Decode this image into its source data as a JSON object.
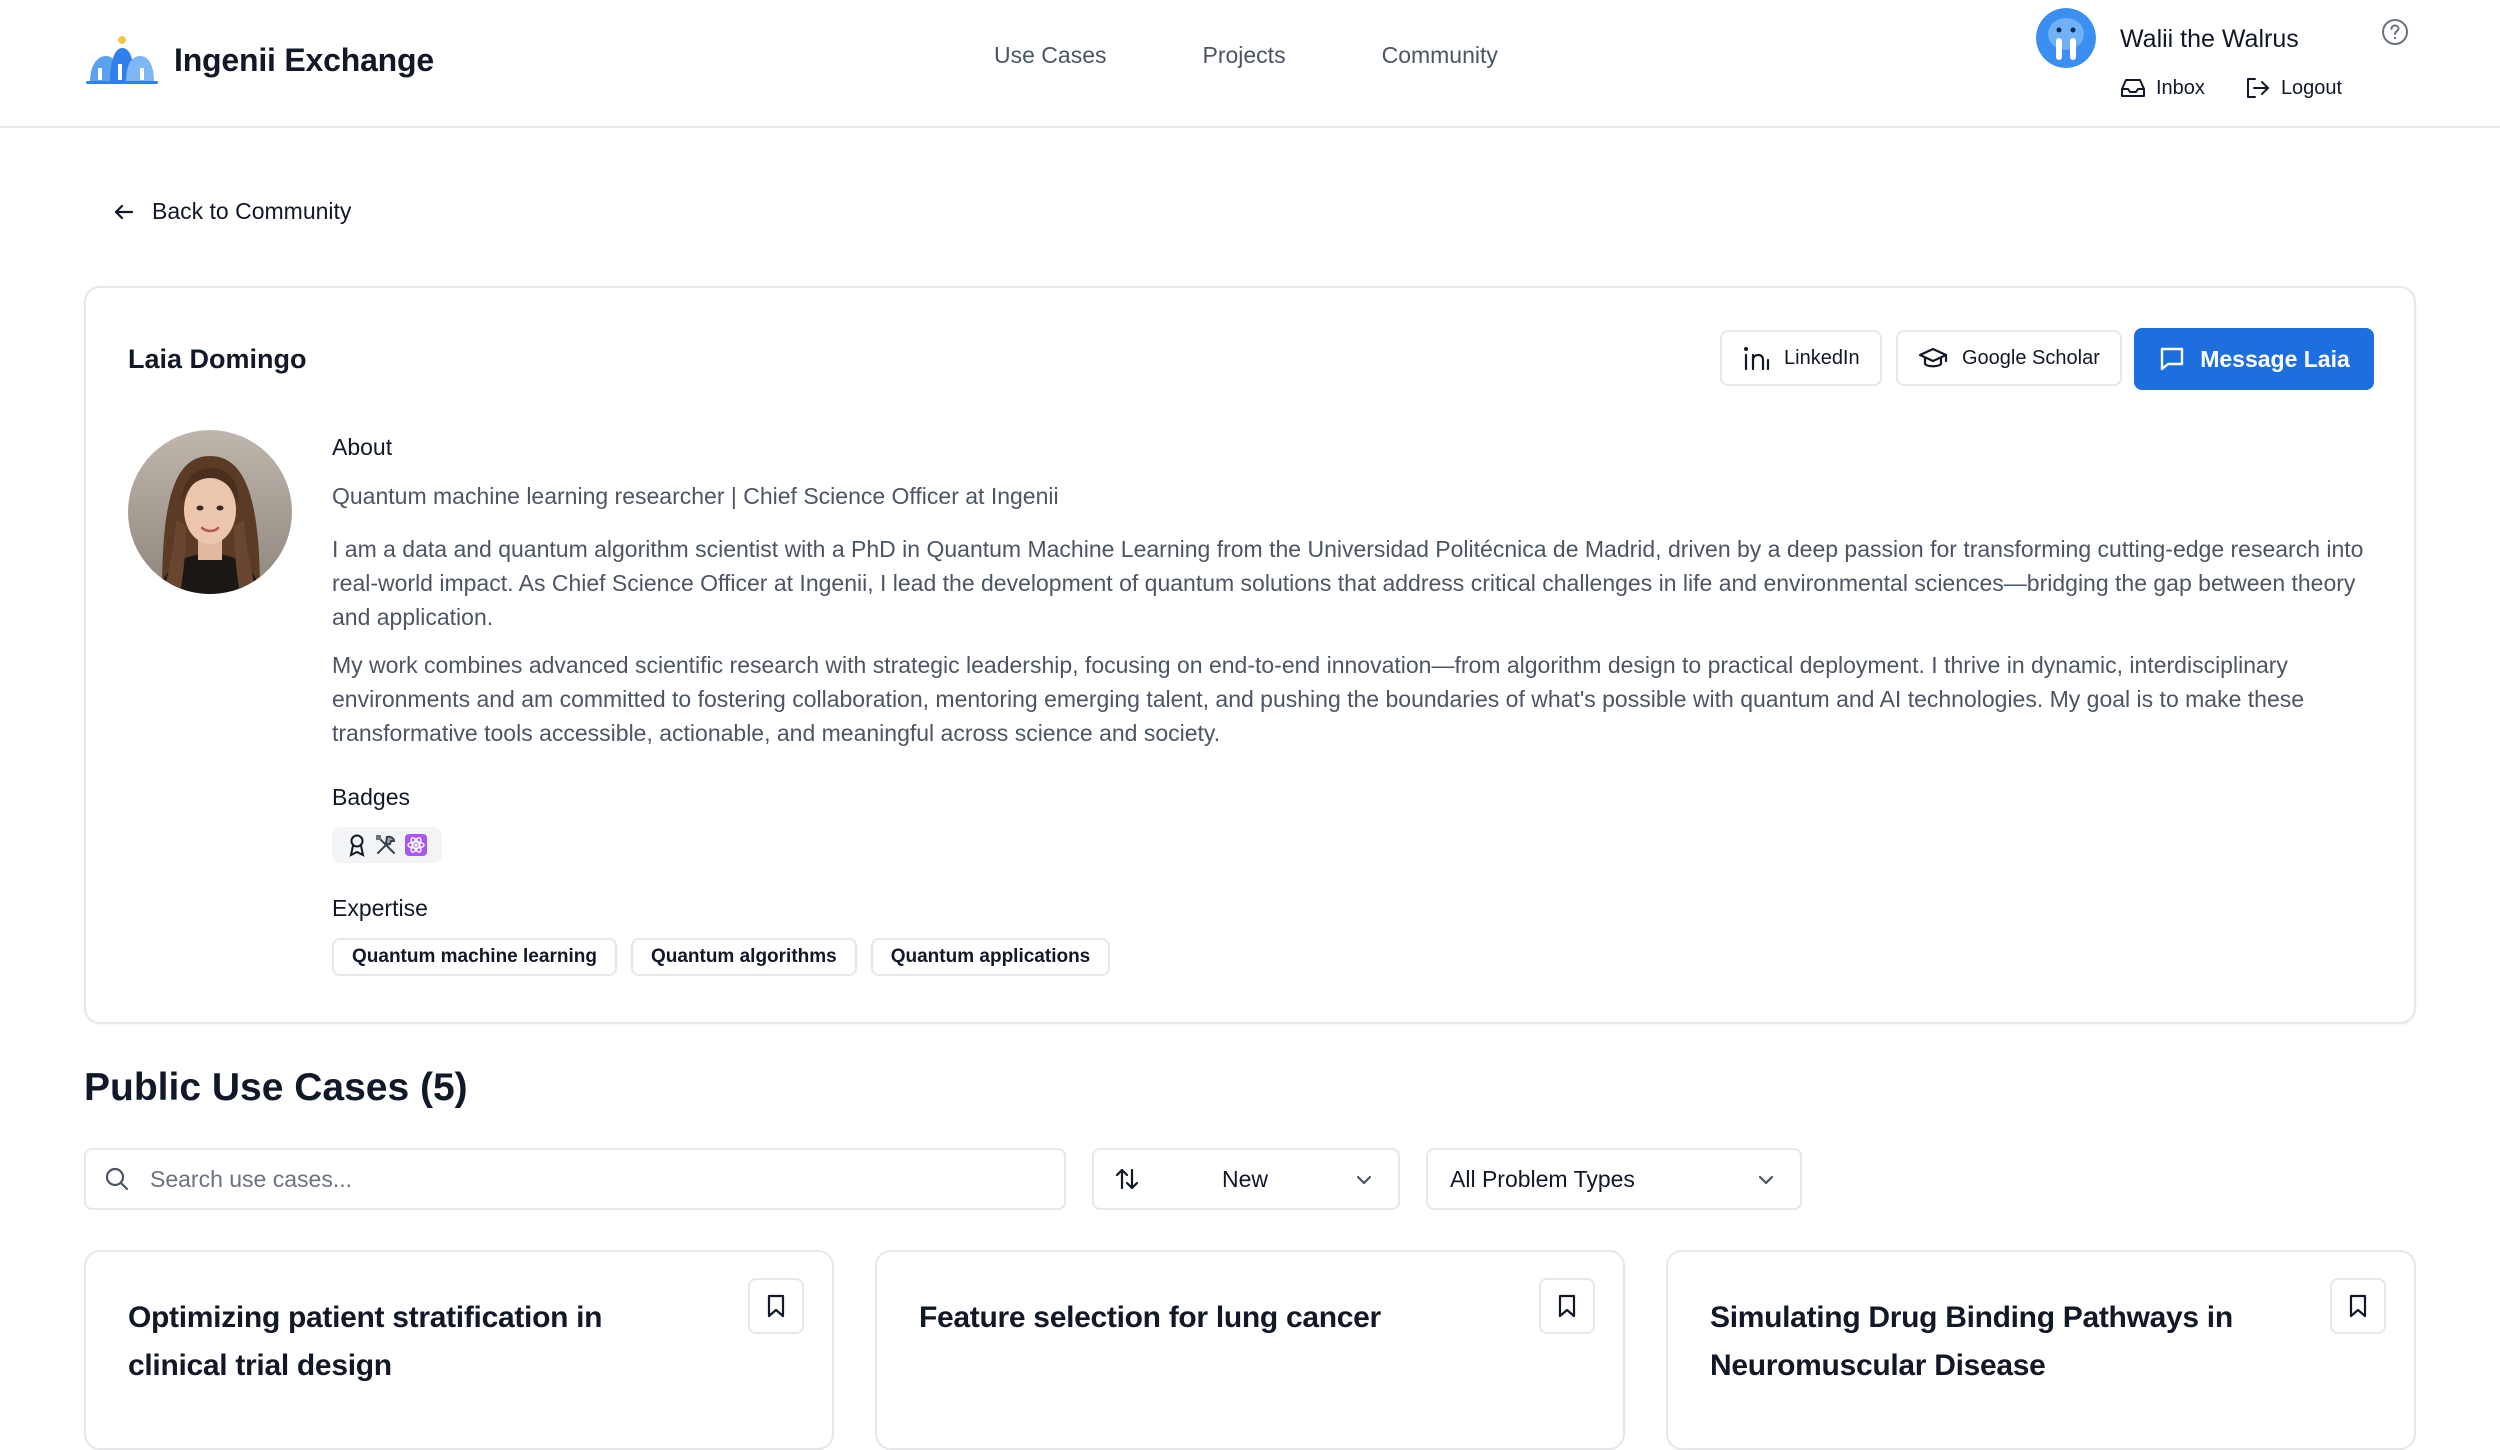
{
  "header": {
    "brand": "Ingenii Exchange",
    "nav": [
      "Use Cases",
      "Projects",
      "Community"
    ],
    "user": {
      "name": "Walii the Walrus",
      "inbox": "Inbox",
      "logout": "Logout"
    }
  },
  "back_label": "Back to Community",
  "profile": {
    "name": "Laia Domingo",
    "linkedin": "LinkedIn",
    "scholar": "Google Scholar",
    "message": "Message Laia",
    "about_heading": "About",
    "tagline": "Quantum machine learning researcher | Chief Science Officer at Ingenii",
    "bio": [
      "I am a data and quantum algorithm scientist with a PhD in Quantum Machine Learning from the Universidad Politécnica de Madrid, driven by a deep passion for transforming cutting-edge research into real-world impact. As Chief Science Officer at Ingenii, I lead the development of quantum solutions that address critical challenges in life and environmental sciences—bridging the gap between theory and application.",
      "My work combines advanced scientific research with strategic leadership, focusing on end-to-end innovation—from algorithm design to practical deployment. I thrive in dynamic, interdisciplinary environments and am committed to fostering collaboration, mentoring emerging talent, and pushing the boundaries of what's possible with quantum and AI technologies. My goal is to make these transformative tools accessible, actionable, and meaningful across science and society."
    ],
    "badges_heading": "Badges",
    "badges": [
      "award-icon",
      "tools-icon",
      "atom-icon"
    ],
    "expertise_heading": "Expertise",
    "expertise": [
      "Quantum machine learning",
      "Quantum algorithms",
      "Quantum applications"
    ]
  },
  "use_cases": {
    "title": "Public Use Cases (5)",
    "search_placeholder": "Search use cases...",
    "sort_value": "New",
    "type_value": "All Problem Types",
    "cards": [
      {
        "title": "Optimizing patient stratification in clinical trial design"
      },
      {
        "title": "Feature selection for lung cancer"
      },
      {
        "title": "Simulating Drug Binding Pathways in Neuromuscular Disease"
      }
    ]
  },
  "colors": {
    "primary": "#1d6fe0",
    "border": "#e5e7eb",
    "muted_text": "#4b5563"
  }
}
